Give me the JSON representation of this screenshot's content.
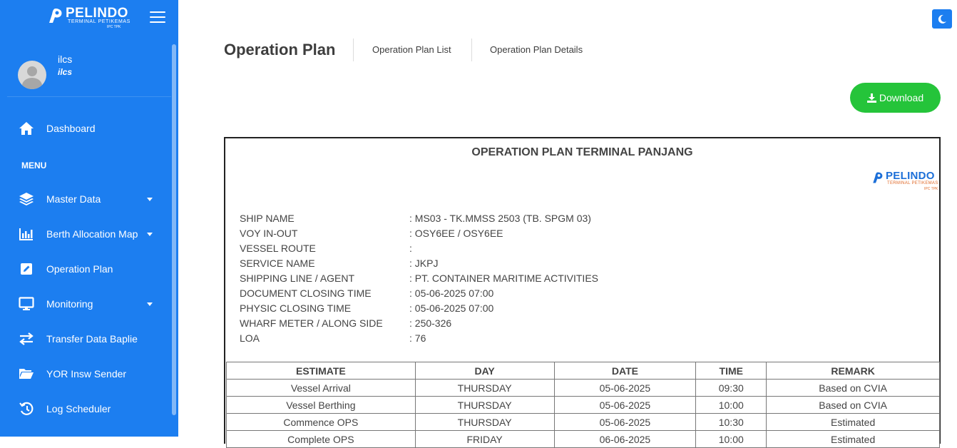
{
  "brand": {
    "name": "PELINDO",
    "sub": "TERMINAL PETIKEMAS",
    "sub2": "IPC TPK"
  },
  "user": {
    "name": "ilcs",
    "role": "ilcs"
  },
  "menu_header": "MENU",
  "sidebar": {
    "items": [
      {
        "label": "Dashboard",
        "icon": "home-icon"
      },
      {
        "label": "Master Data",
        "icon": "layers-icon",
        "has_dropdown": true
      },
      {
        "label": "Berth Allocation Map",
        "icon": "bar-chart-icon",
        "has_dropdown": true
      },
      {
        "label": "Operation Plan",
        "icon": "edit-icon"
      },
      {
        "label": "Monitoring",
        "icon": "monitor-icon",
        "has_dropdown": true
      },
      {
        "label": "Transfer Data Baplie",
        "icon": "exchange-icon"
      },
      {
        "label": "YOR Insw Sender",
        "icon": "folder-open-icon"
      },
      {
        "label": "Log Scheduler",
        "icon": "history-icon"
      }
    ]
  },
  "header": {
    "title": "Operation Plan",
    "tabs": [
      "Operation Plan List",
      "Operation Plan Details"
    ]
  },
  "download_label": "Download",
  "report": {
    "title": "OPERATION PLAN TERMINAL PANJANG",
    "logo": {
      "name": "PELINDO",
      "sub": "TERMINAL PETIKEMAS",
      "sub2": "IPC TPK"
    },
    "fields": [
      {
        "key": "SHIP NAME",
        "value": ": MS03 - TK.MMSS 2503 (TB. SPGM 03)"
      },
      {
        "key": "VOY IN-OUT",
        "value": ": OSY6EE / OSY6EE"
      },
      {
        "key": "VESSEL ROUTE",
        "value": ":"
      },
      {
        "key": "SERVICE NAME",
        "value": ": JKPJ"
      },
      {
        "key": "SHIPPING LINE / AGENT",
        "value": ": PT. CONTAINER MARITIME ACTIVITIES"
      },
      {
        "key": "DOCUMENT CLOSING TIME",
        "value": ": 05-06-2025 07:00"
      },
      {
        "key": "PHYSIC CLOSING TIME",
        "value": ": 05-06-2025 07:00"
      },
      {
        "key": "WHARF METER / ALONG SIDE",
        "value": ": 250-326"
      },
      {
        "key": "LOA",
        "value": ": 76"
      }
    ],
    "table": {
      "headers": [
        "ESTIMATE",
        "DAY",
        "DATE",
        "TIME",
        "REMARK"
      ],
      "rows": [
        [
          "Vessel Arrival",
          "THURSDAY",
          "05-06-2025",
          "09:30",
          "Based on CVIA"
        ],
        [
          "Vessel Berthing",
          "THURSDAY",
          "05-06-2025",
          "10:00",
          "Based on CVIA"
        ],
        [
          "Commence OPS",
          "THURSDAY",
          "05-06-2025",
          "10:30",
          "Estimated"
        ],
        [
          "Complete OPS",
          "FRIDAY",
          "06-06-2025",
          "10:00",
          "Estimated"
        ]
      ]
    }
  },
  "colors": {
    "sidebar": "#1c7ef0",
    "download": "#25c43a"
  }
}
